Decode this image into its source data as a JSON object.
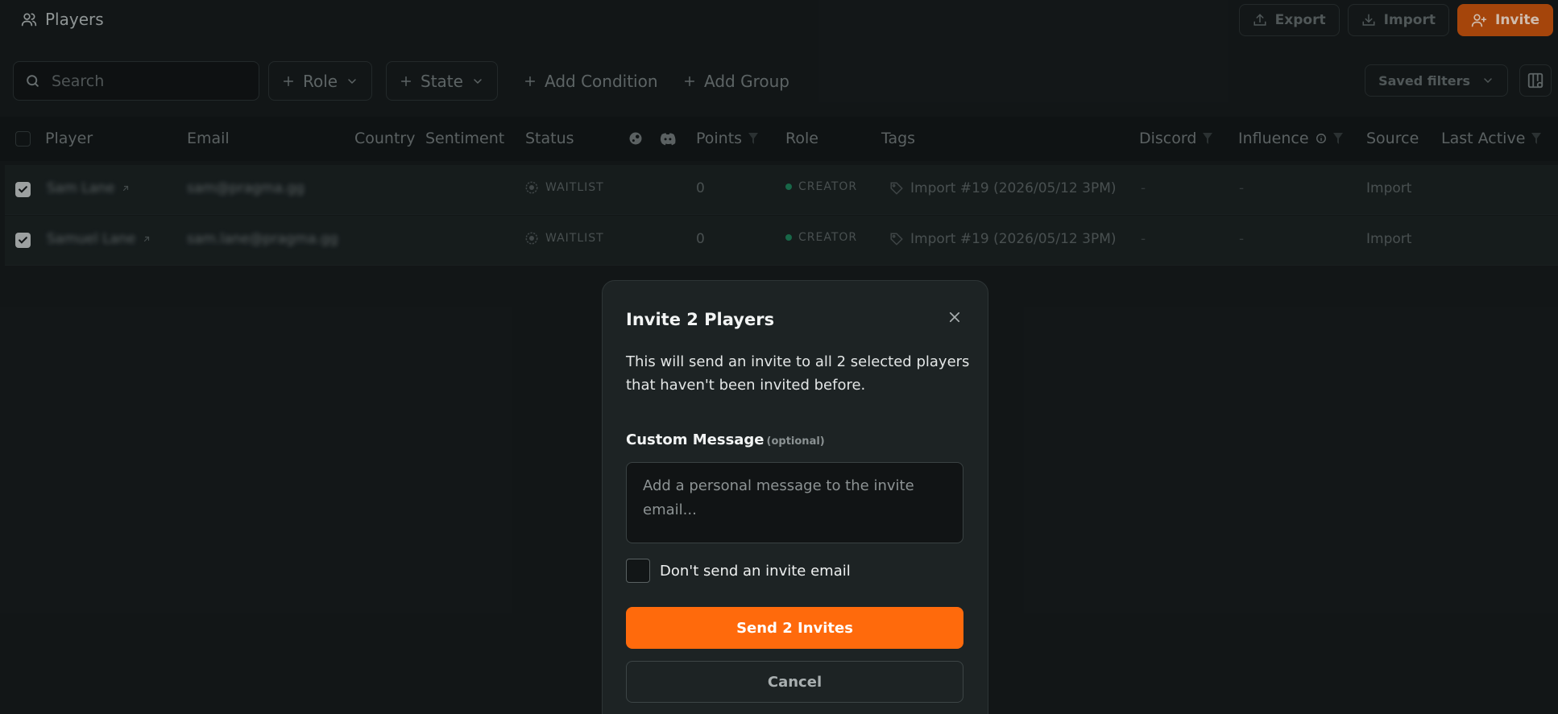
{
  "header": {
    "title": "Players",
    "export_label": "Export",
    "import_label": "Import",
    "invite_label": "Invite"
  },
  "filters": {
    "search_placeholder": "Search",
    "role_label": "Role",
    "state_label": "State",
    "add_condition_label": "Add Condition",
    "add_group_label": "Add Group",
    "saved_filters_label": "Saved filters"
  },
  "table": {
    "columns": {
      "player": "Player",
      "email": "Email",
      "country": "Country",
      "sentiment": "Sentiment",
      "status": "Status",
      "points": "Points",
      "role": "Role",
      "tags": "Tags",
      "discord": "Discord",
      "influence": "Influence",
      "source": "Source",
      "last_active": "Last Active"
    },
    "rows": [
      {
        "player": "Sam Lane",
        "email": "sam@pragma.gg",
        "status": "WAITLIST",
        "points": "0",
        "role": "CREATOR",
        "tag": "Import #19 (2026/05/12 3PM)",
        "discord": "-",
        "influence": "-",
        "source": "Import"
      },
      {
        "player": "Samuel Lane",
        "email": "sam.lane@pragma.gg",
        "status": "WAITLIST",
        "points": "0",
        "role": "CREATOR",
        "tag": "Import #19 (2026/05/12 3PM)",
        "discord": "-",
        "influence": "-",
        "source": "Import"
      }
    ]
  },
  "dialog": {
    "title": "Invite 2 Players",
    "description": "This will send an invite to all 2 selected players that haven't been invited before.",
    "custom_message_label": "Custom Message",
    "optional_label": "(optional)",
    "message_placeholder": "Add a personal message to the invite email...",
    "no_email_label": "Don't send an invite email",
    "send_label": "Send 2 Invites",
    "cancel_label": "Cancel"
  },
  "colors": {
    "accent": "#ff6a0c",
    "background": "#161b1c",
    "dialog_bg": "#1d2324"
  }
}
